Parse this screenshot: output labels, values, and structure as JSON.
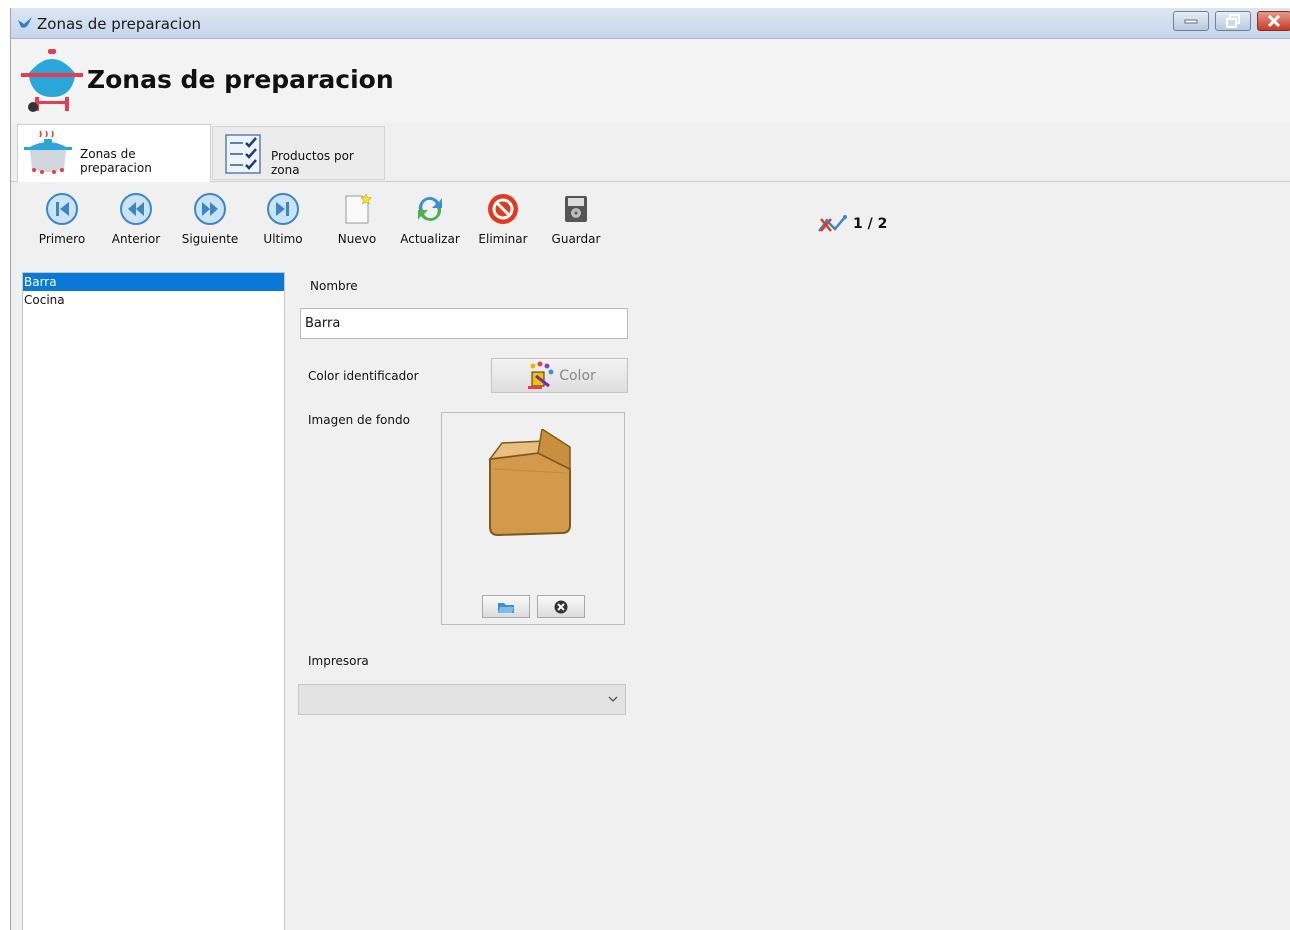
{
  "window": {
    "title": "Zonas de preparacion"
  },
  "header": {
    "title": "Zonas de preparacion",
    "logo_icon": "grill-icon"
  },
  "tabs": [
    {
      "label": "Zonas de preparacion",
      "icon": "cooking-pot-icon",
      "active": true
    },
    {
      "label": "Productos por zona",
      "icon": "checklist-icon",
      "active": false
    }
  ],
  "toolbar": {
    "first_label": "Primero",
    "previous_label": "Anterior",
    "next_label": "Siguiente",
    "last_label": "Ultimo",
    "new_label": "Nuevo",
    "refresh_label": "Actualizar",
    "delete_label": "Eliminar",
    "save_label": "Guardar"
  },
  "record_counter": "1 / 2",
  "list": {
    "items": [
      "Barra",
      "Cocina"
    ],
    "selected": "Barra"
  },
  "form": {
    "name_label": "Nombre",
    "name_value": "Barra",
    "color_label": "Color identificador",
    "color_button_label": "Color",
    "image_label": "Imagen de fondo",
    "printer_label": "Impresora",
    "printer_value": ""
  },
  "colors": {
    "selection": "#0a78d7",
    "close_button": "#c53b25",
    "nav_button": "#3d86c6"
  }
}
